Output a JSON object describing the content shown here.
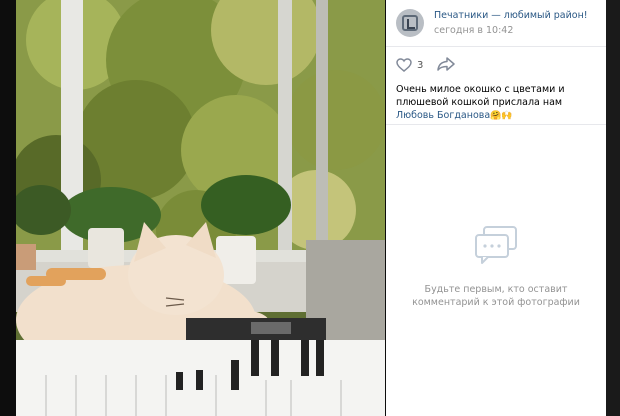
{
  "post": {
    "group_name": "Печатники — любимый район!",
    "time": "сегодня в 10:42",
    "likes": "3",
    "caption_text": "Очень милое окошко с цветами и плюшевой кошкой прислала нам ",
    "caption_author": "Любовь Богданова",
    "caption_emojis": "🤗🙌"
  },
  "comments": {
    "empty_line1": "Будьте первым, кто оставит",
    "empty_line2": "комментарий к этой фотографии"
  },
  "icons": {
    "like": "heart-icon",
    "share": "share-arrow-icon",
    "comments": "comments-bubble-icon"
  },
  "colors": {
    "link": "#2a5885",
    "muted": "#939393"
  }
}
